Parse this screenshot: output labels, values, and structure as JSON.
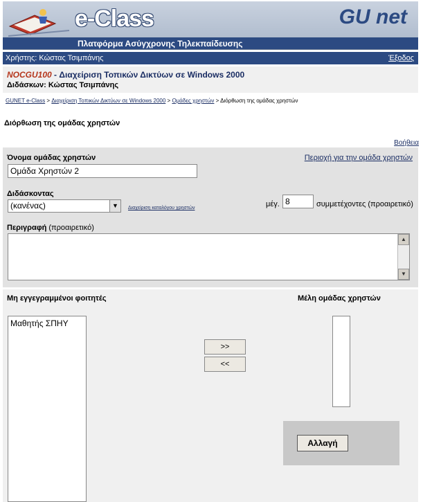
{
  "header": {
    "logo_text": "e-Class",
    "subtitle": "Πλατφόρμα Ασύγχρονης Τηλεκπαίδευσης",
    "partner_logo": "GU net"
  },
  "userbar": {
    "user_label": "Χρήστης: Κώστας Τσιμπάνης",
    "logout": "Έξοδος"
  },
  "course": {
    "code": "NOCGU100",
    "separator": " - ",
    "title": "Διαχείριση Τοπικών Δικτύων σε Windows 2000",
    "teacher": "Διδάσκων: Κώστας Τσιμπάνης"
  },
  "breadcrumb": {
    "items": [
      "GUNET e-Class",
      "Διαχείριση Τοπικών Δικτύων σε Windows 2000",
      "Ομάδες χρηστών"
    ],
    "separator": " > ",
    "current": "Διόρθωση της ομάδας χρηστών"
  },
  "page_title": "Διόρθωση της ομάδας χρηστών",
  "help_link": "Βοήθεια",
  "form": {
    "group_name_label": "Όνομα ομάδας χρηστών",
    "group_name_value": "Ομάδα Χρηστών 2",
    "group_area_link": "Περιοχή για την ομάδα χρηστών",
    "tutor_label": "Διδάσκοντας",
    "tutor_selected": "(κανένας)",
    "manage_tutors_link": "Διαχείριση καταλόγου χρηστών",
    "max_label": "μέγ.",
    "max_value": "8",
    "max_suffix": "συμμετέχοντες (προαιρετικό)",
    "description_label": "Περιγραφή",
    "description_note": "(προαιρετικό)",
    "description_value": ""
  },
  "members": {
    "unregistered_label": "Μη εγγεγραμμένοι φοιτητές",
    "unregistered_items": [
      "Μαθητής ΣΠΗΥ"
    ],
    "group_members_label": "Μέλη ομάδας χρηστών",
    "group_members_items": [],
    "add_button": ">>",
    "remove_button": "<<"
  },
  "submit_label": "Αλλαγή"
}
